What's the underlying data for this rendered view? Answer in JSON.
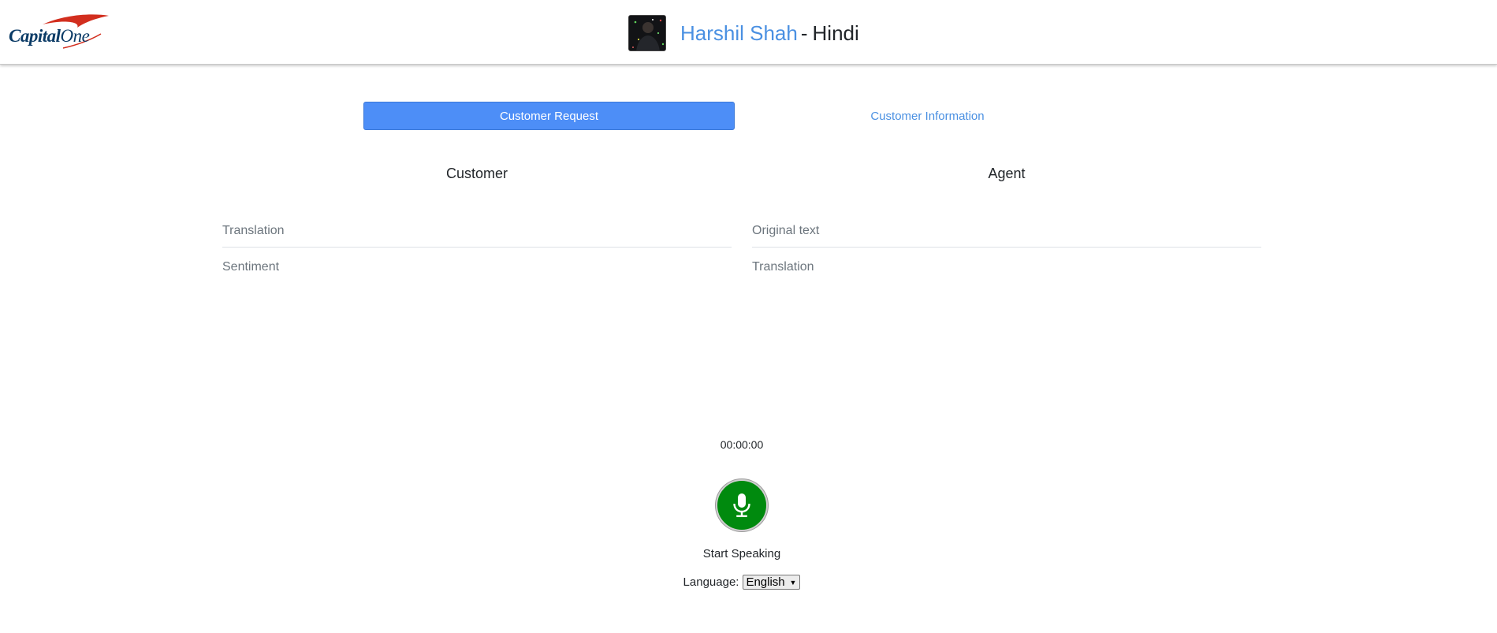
{
  "brand": {
    "logo_text_bold": "Capital",
    "logo_text_light": "One",
    "accent": "#d22e1e",
    "navy": "#0b3b66"
  },
  "header": {
    "customer_name": "Harshil Shah",
    "separator": "-",
    "language": "Hindi",
    "name_color": "#4a90e2"
  },
  "tabs": [
    {
      "label": "Customer Request",
      "active": true
    },
    {
      "label": "Customer Information",
      "active": false
    }
  ],
  "customer_panel": {
    "heading": "Customer",
    "fields": [
      "Translation",
      "Sentiment"
    ]
  },
  "agent_panel": {
    "heading": "Agent",
    "fields": [
      "Original text",
      "Translation"
    ]
  },
  "recorder": {
    "timer": "00:00:00",
    "mic_icon": "microphone-icon",
    "button_color": "#008a0e",
    "status": "Start Speaking",
    "language_label": "Language:",
    "language_selected": "English"
  }
}
